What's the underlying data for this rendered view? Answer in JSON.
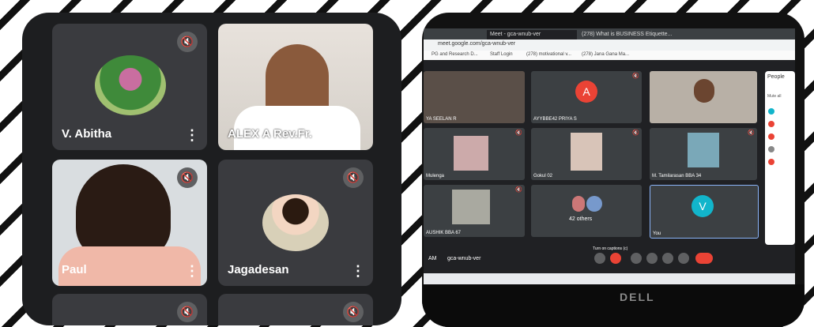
{
  "left_panel": {
    "tiles": [
      {
        "name": "V. Abitha",
        "muted": true
      },
      {
        "name": "ALEX A Rev.Fr.",
        "muted": false
      },
      {
        "name": "Paul",
        "muted": true
      },
      {
        "name": "Jagadesan",
        "muted": true
      }
    ]
  },
  "browser": {
    "tabs": [
      "Meet - gca-wnub-ver",
      "(278) What is BUSINESS Etiquette..."
    ],
    "url": "meet.google.com/gca-wnub-ver",
    "bookmarks": [
      "PG and Research D...",
      "Staff Login",
      "(278) motivational v...",
      "(278) Jana Gana Ma..."
    ]
  },
  "meet": {
    "participants": [
      {
        "name": "YA SEELAN R",
        "initial": ""
      },
      {
        "name": "AYYBBE42 PRIYA S",
        "initial": "A"
      },
      {
        "name": "",
        "initial": ""
      },
      {
        "name": "Mulenga",
        "initial": ""
      },
      {
        "name": "Gokul 02",
        "initial": ""
      },
      {
        "name": "M. Tamilarasan BBA 34",
        "initial": ""
      },
      {
        "name": "AUSHIK BBA 67",
        "initial": ""
      },
      {
        "name": "42 others",
        "initial": ""
      },
      {
        "name": "You",
        "initial": "V"
      }
    ],
    "people_title": "People",
    "mute_all": "Mute all",
    "meeting_time": "AM",
    "meeting_code": "gca-wnub-ver",
    "turn_on_captions": "Turn on captions (c)"
  },
  "laptop_brand": "DELL",
  "colors": {
    "meet_red": "#ea4335",
    "meet_teal": "#12b5cb",
    "tile_bg": "#3c4043",
    "panel_bg": "#1d1e20"
  },
  "icons": [
    "mic-off-icon",
    "more-vert-icon",
    "end-call-icon",
    "present-icon",
    "people-icon"
  ]
}
